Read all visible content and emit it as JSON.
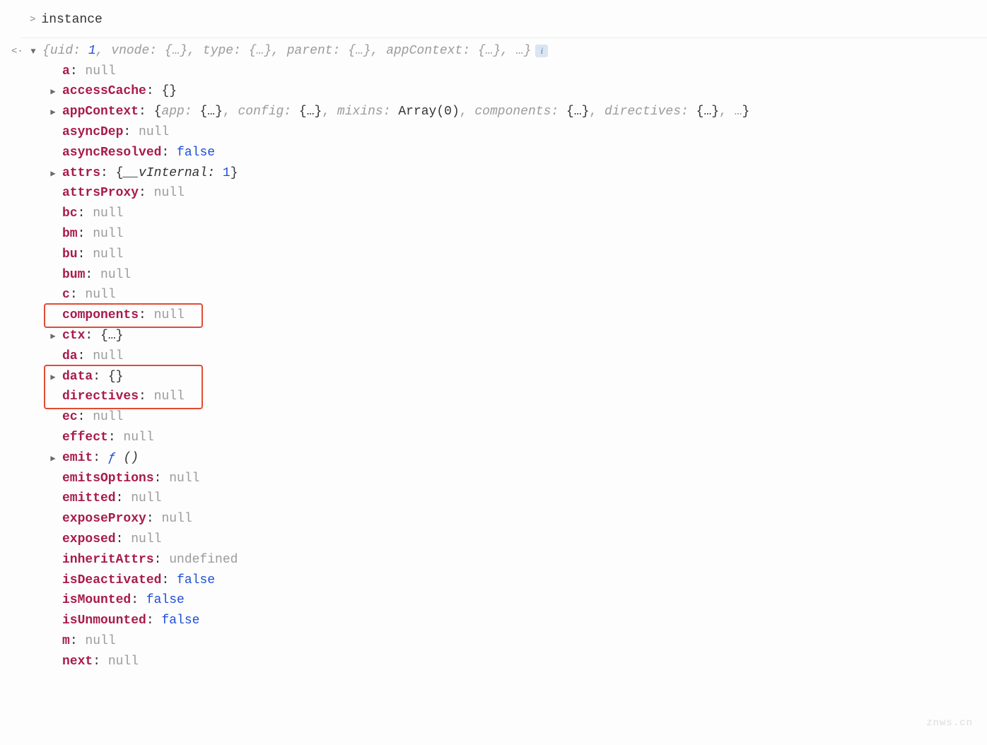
{
  "header": {
    "prompt": ">",
    "text": "instance"
  },
  "summary": {
    "pairs": [
      {
        "k": "uid",
        "v": "1",
        "vtype": "num",
        "sep": ", "
      },
      {
        "k": "vnode",
        "v": "{…}",
        "vtype": "obj",
        "sep": ", "
      },
      {
        "k": "type",
        "v": "{…}",
        "vtype": "obj",
        "sep": ", "
      },
      {
        "k": "parent",
        "v": "{…}",
        "vtype": "obj",
        "sep": ", "
      },
      {
        "k": "appContext",
        "v": "{…}",
        "vtype": "obj",
        "sep": ", "
      }
    ],
    "trailing": "…}"
  },
  "appContext": {
    "app": "{…}",
    "config": "{…}",
    "mixins": "Array(0)",
    "components": "{…}",
    "directives": "{…}"
  },
  "attrs": {
    "key": "__vInternal",
    "val": "1"
  },
  "properties": [
    {
      "key": "a",
      "value": "null",
      "vtype": "null",
      "expandable": false
    },
    {
      "key": "accessCache",
      "value": "{}",
      "vtype": "obj",
      "expandable": true
    },
    {
      "key": "appContext",
      "value": "__APPCONTEXT__",
      "vtype": "inline",
      "expandable": true
    },
    {
      "key": "asyncDep",
      "value": "null",
      "vtype": "null",
      "expandable": false
    },
    {
      "key": "asyncResolved",
      "value": "false",
      "vtype": "bool",
      "expandable": false
    },
    {
      "key": "attrs",
      "value": "__ATTRS__",
      "vtype": "inline",
      "expandable": true
    },
    {
      "key": "attrsProxy",
      "value": "null",
      "vtype": "null",
      "expandable": false
    },
    {
      "key": "bc",
      "value": "null",
      "vtype": "null",
      "expandable": false
    },
    {
      "key": "bm",
      "value": "null",
      "vtype": "null",
      "expandable": false
    },
    {
      "key": "bu",
      "value": "null",
      "vtype": "null",
      "expandable": false
    },
    {
      "key": "bum",
      "value": "null",
      "vtype": "null",
      "expandable": false
    },
    {
      "key": "c",
      "value": "null",
      "vtype": "null",
      "expandable": false
    },
    {
      "key": "components",
      "value": "null",
      "vtype": "null",
      "expandable": false,
      "highlight": 1
    },
    {
      "key": "ctx",
      "value": "{…}",
      "vtype": "obj",
      "expandable": true
    },
    {
      "key": "da",
      "value": "null",
      "vtype": "null",
      "expandable": false
    },
    {
      "key": "data",
      "value": "{}",
      "vtype": "obj",
      "expandable": true,
      "highlight": 2
    },
    {
      "key": "directives",
      "value": "null",
      "vtype": "null",
      "expandable": false,
      "highlight": 2
    },
    {
      "key": "ec",
      "value": "null",
      "vtype": "null",
      "expandable": false
    },
    {
      "key": "effect",
      "value": "null",
      "vtype": "null",
      "expandable": false
    },
    {
      "key": "emit",
      "value": "ƒ ()",
      "vtype": "func",
      "expandable": true
    },
    {
      "key": "emitsOptions",
      "value": "null",
      "vtype": "null",
      "expandable": false
    },
    {
      "key": "emitted",
      "value": "null",
      "vtype": "null",
      "expandable": false
    },
    {
      "key": "exposeProxy",
      "value": "null",
      "vtype": "null",
      "expandable": false
    },
    {
      "key": "exposed",
      "value": "null",
      "vtype": "null",
      "expandable": false
    },
    {
      "key": "inheritAttrs",
      "value": "undefined",
      "vtype": "undef",
      "expandable": false
    },
    {
      "key": "isDeactivated",
      "value": "false",
      "vtype": "bool",
      "expandable": false
    },
    {
      "key": "isMounted",
      "value": "false",
      "vtype": "bool",
      "expandable": false
    },
    {
      "key": "isUnmounted",
      "value": "false",
      "vtype": "bool",
      "expandable": false
    },
    {
      "key": "m",
      "value": "null",
      "vtype": "null",
      "expandable": false
    },
    {
      "key": "next",
      "value": "null",
      "vtype": "null",
      "expandable": false
    }
  ],
  "watermark": "znws.cn"
}
